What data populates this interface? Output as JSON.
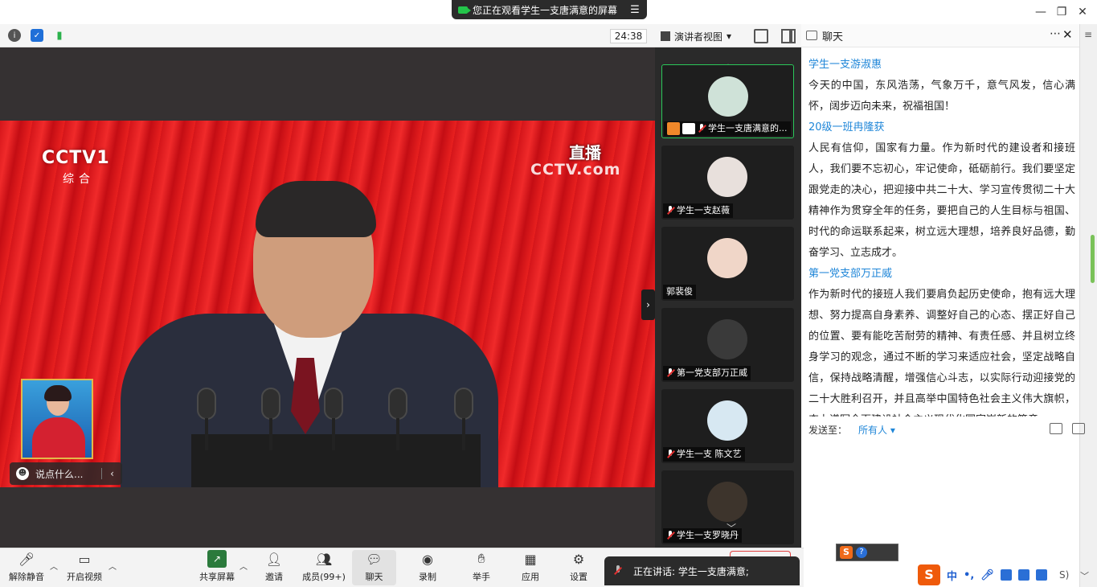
{
  "banner": {
    "text": "您正在观看学生一支唐满意的屏幕"
  },
  "toolbar": {
    "timer": "24:38",
    "view_label": "演讲者视图"
  },
  "video": {
    "channel_logo": "CCTV1",
    "channel_sub": "综合",
    "live_badge": "直播",
    "site_mark": "CCTV.com",
    "comment_placeholder": "说点什么..."
  },
  "participants": [
    {
      "name": "学生一支唐满意的...",
      "active": true,
      "avatar_color": "#cfe2d8"
    },
    {
      "name": "学生一支赵薇",
      "active": false,
      "avatar_color": "#e8e0dc"
    },
    {
      "name": "郭裴俊",
      "active": false,
      "avatar_color": "#f0d6c8"
    },
    {
      "name": "第一党支部万正威",
      "active": false,
      "avatar_color": "#3a3a3a"
    },
    {
      "name": "学生一支 陈文艺",
      "active": false,
      "avatar_color": "#d7e8f2"
    },
    {
      "name": "学生一支罗晓丹",
      "active": false,
      "avatar_color": "#3d342c"
    }
  ],
  "chat": {
    "title": "聊天",
    "messages": [
      {
        "author": "学生一支游淑惠",
        "text": "今天的中国，东风浩荡，气象万千，意气风发，信心满怀，阔步迈向未来，祝福祖国！"
      },
      {
        "author": "20级一班冉隆获",
        "text": "人民有信仰，国家有力量。作为新时代的建设者和接班人，我们要不忘初心，牢记使命，砥砺前行。我们要坚定跟党走的决心，把迎接中共二十大、学习宣传贯彻二十大精神作为贯穿全年的任务，要把自己的人生目标与祖国、时代的命运联系起来，树立远大理想，培养良好品德，勤奋学习、立志成才。"
      },
      {
        "author": "第一党支部万正威",
        "text": "作为新时代的接班人我们要肩负起历史使命，抱有远大理想、努力提高自身素养、调整好自己的心态、摆正好自己的位置、要有能吃苦耐劳的精神、有责任感、并且树立终身学习的观念，通过不断的学习来适应社会，坚定战略自信，保持战略清醒，增强信心斗志，以实际行动迎接党的二十大胜利召开，并且高举中国特色社会主义伟大旗帜，奋力谱写全面建设社会主义现代化国家崭新的篇章"
      }
    ],
    "send_to_label": "发送至：",
    "send_to_value": "所有人"
  },
  "controls": {
    "unmute": "解除静音",
    "start_video": "开启视频",
    "share_screen": "共享屏幕",
    "invite": "邀请",
    "members": "成员(99+)",
    "chat": "聊天",
    "record": "录制",
    "raise_hand": "举手",
    "apps": "应用",
    "settings": "设置"
  },
  "speaking": {
    "text": "正在讲话: 学生一支唐满意;"
  },
  "ime": {
    "mode": "中",
    "tail": "S)"
  }
}
